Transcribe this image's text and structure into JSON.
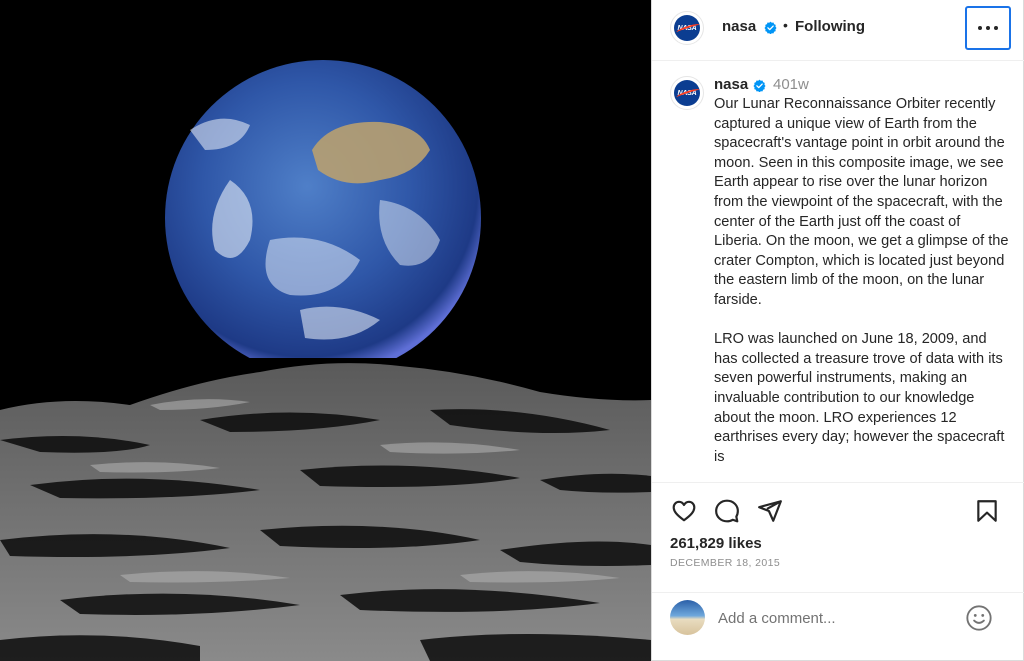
{
  "post": {
    "author": {
      "username": "nasa",
      "verified": true,
      "follow_status": "Following",
      "separator": "•"
    },
    "caption": {
      "username": "nasa",
      "age": "401w",
      "text": "Our Lunar Reconnaissance Orbiter recently captured a unique view of Earth from the spacecraft's vantage point in orbit around the moon. Seen in this composite image, we see Earth appear to rise over the lunar horizon from the viewpoint of the spacecraft, with the center of the Earth just off the coast of Liberia. On the moon, we get a glimpse of the crater Compton, which is located just beyond the eastern limb of the moon, on the lunar farside.\n\nLRO was launched on June 18, 2009, and has collected a treasure trove of data with its seven powerful instruments, making an invaluable contribution to our knowledge about the moon. LRO experiences 12 earthrises every day; however the spacecraft is"
    },
    "likes": "261,829 likes",
    "date": "December 18, 2015",
    "comment": {
      "placeholder": "Add a comment..."
    },
    "icons": {
      "like": "heart-icon",
      "comment": "comment-bubble-icon",
      "share": "paper-plane-icon",
      "save": "bookmark-icon",
      "more": "more-options-icon",
      "emoji": "emoji-smile-icon",
      "verified": "verified-badge-icon"
    },
    "colors": {
      "verified_blue": "#0095f6",
      "focus_ring": "#1a73e8",
      "text_primary": "#262626",
      "text_secondary": "#8e8e8e"
    }
  }
}
